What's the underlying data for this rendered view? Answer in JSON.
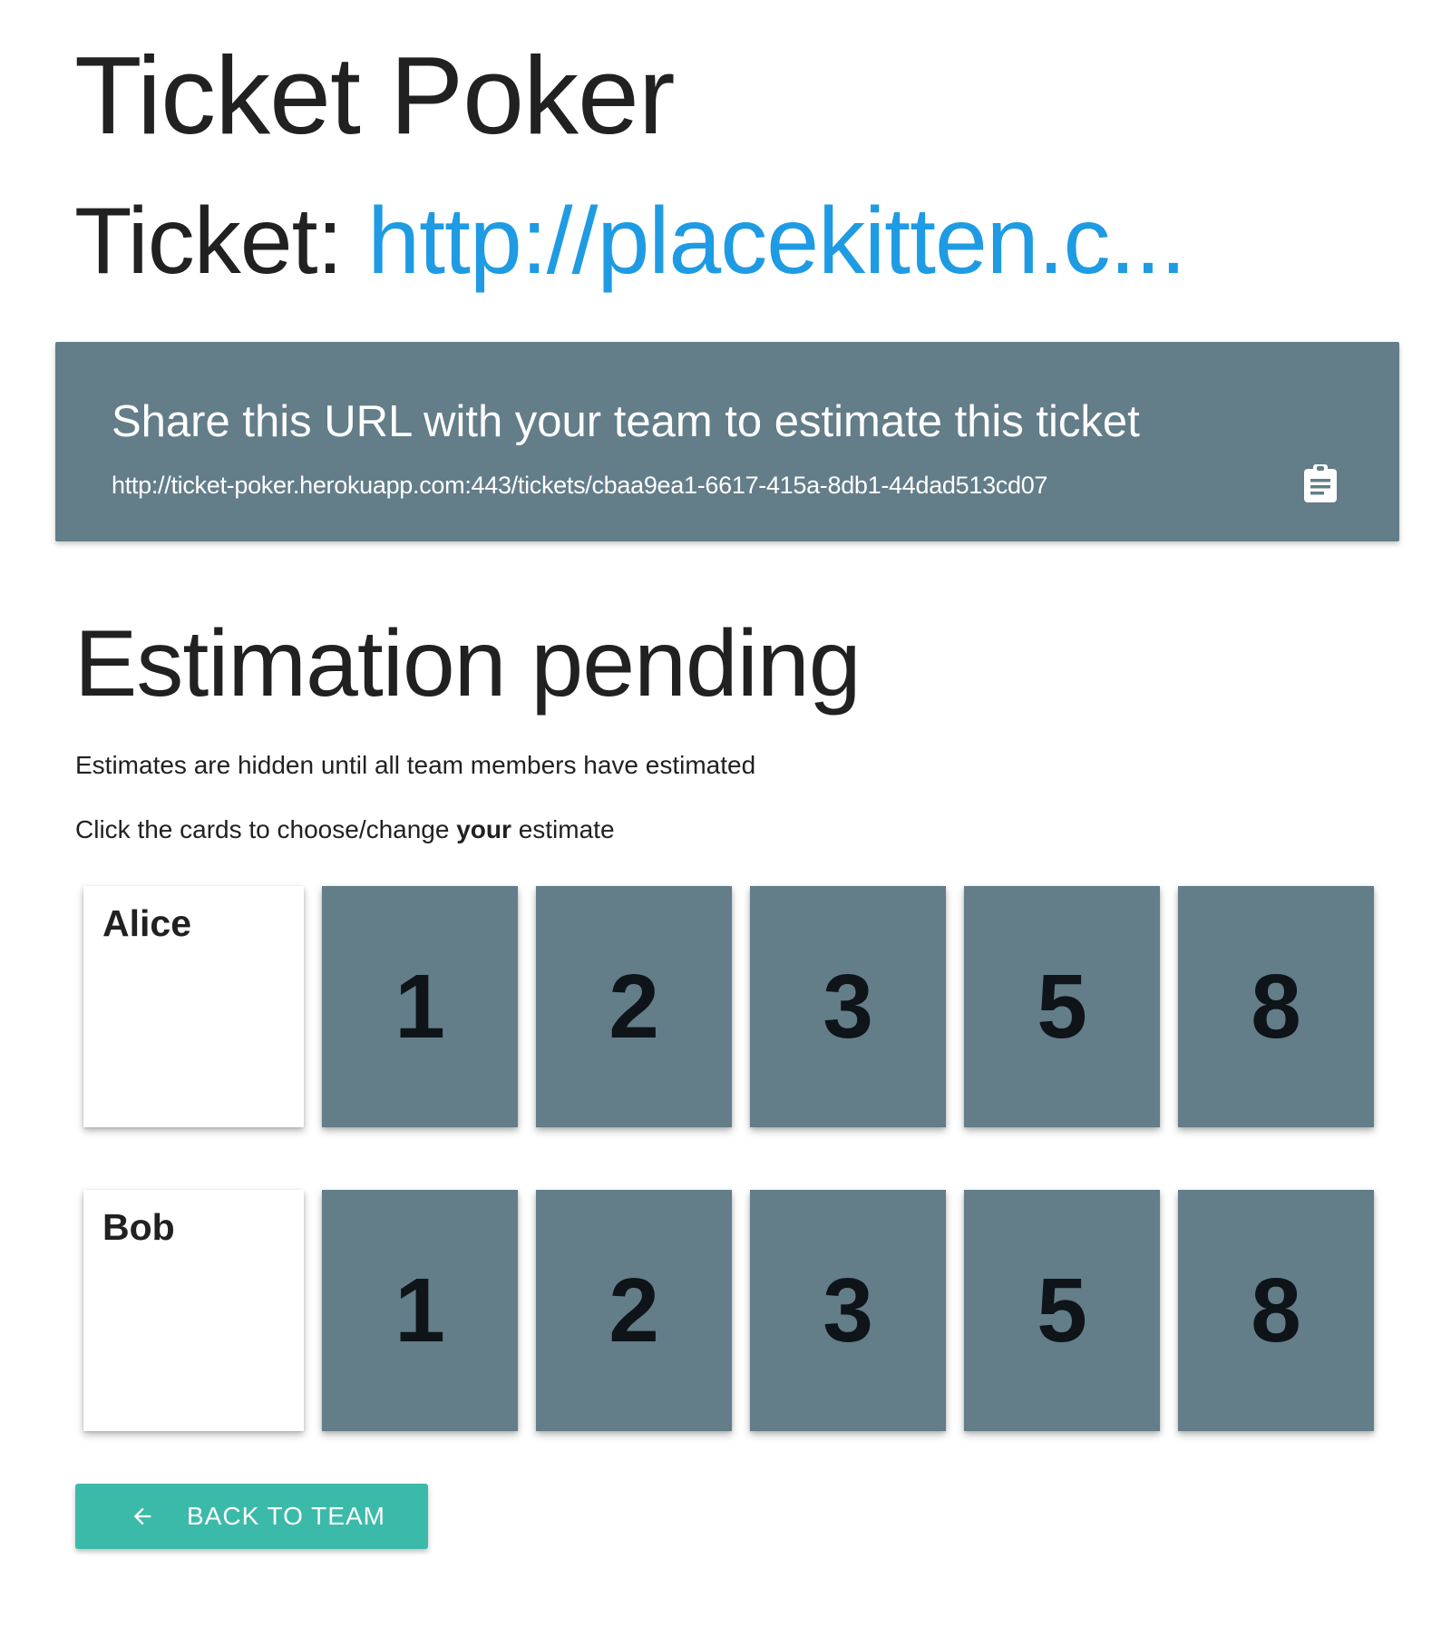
{
  "header": {
    "app_title": "Ticket Poker",
    "ticket_prefix": "Ticket: ",
    "ticket_link": "http://placekitten.c..."
  },
  "share": {
    "title": "Share this URL with your team to estimate this ticket",
    "url": "http://ticket-poker.herokuapp.com:443/tickets/cbaa9ea1-6617-415a-8db1-44dad513cd07",
    "copy_icon": "clipboard-icon"
  },
  "estimation": {
    "status": "Estimation pending",
    "hidden_note": "Estimates are hidden until all team members have estimated",
    "instruction_prefix": "Click the cards to choose/change ",
    "instruction_bold": "your",
    "instruction_suffix": " estimate"
  },
  "members": [
    {
      "name": "Alice",
      "cards": [
        "1",
        "2",
        "3",
        "5",
        "8"
      ]
    },
    {
      "name": "Bob",
      "cards": [
        "1",
        "2",
        "3",
        "5",
        "8"
      ]
    }
  ],
  "actions": {
    "back_label": "BACK TO TEAM",
    "back_icon": "arrow-left-icon"
  },
  "colors": {
    "panel": "#637d89",
    "link": "#1e9be3",
    "button": "#3cbaa9"
  }
}
